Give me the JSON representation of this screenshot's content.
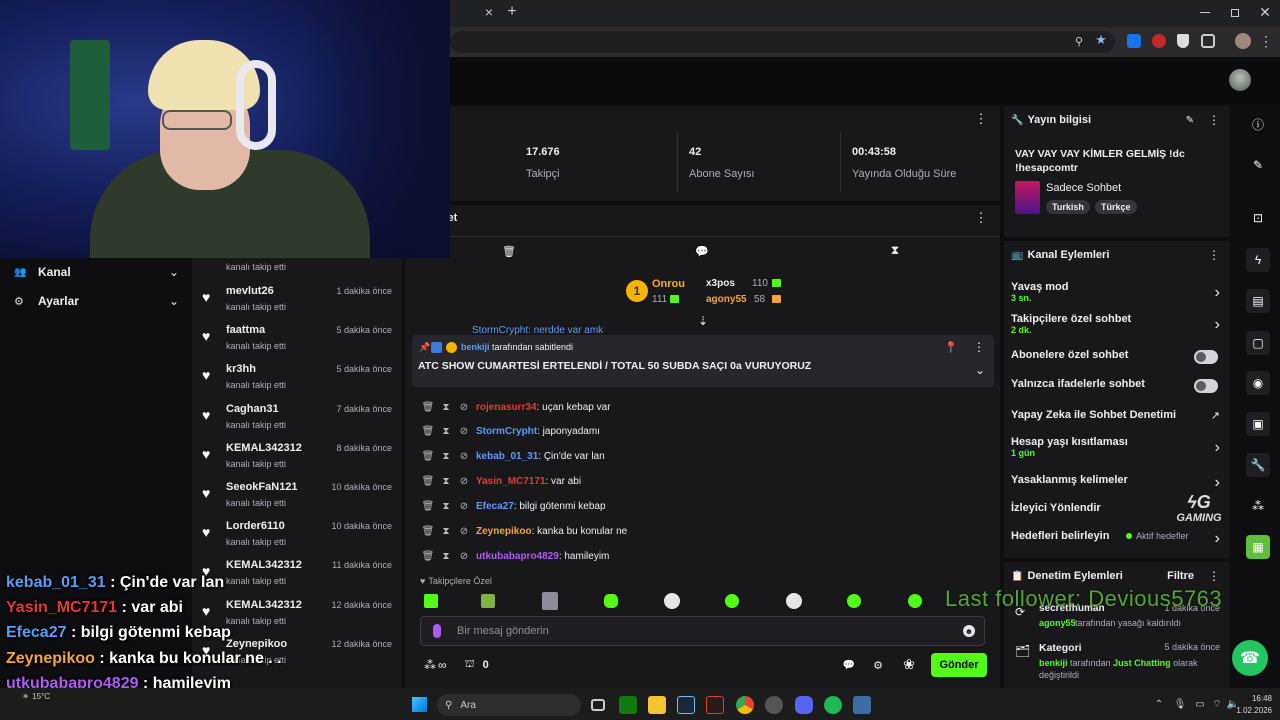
{
  "browser": {
    "tab_close": "×",
    "tab_new": "+",
    "window_controls": [
      "minimize-icon",
      "restore-icon",
      "close-icon"
    ]
  },
  "stats": {
    "followers_value": "17.676",
    "followers_label": "Takipçi",
    "subs_value": "42",
    "subs_label": "Abone Sayısı",
    "uptime_value": "00:43:58",
    "uptime_label": "Yayında Olduğu Süre"
  },
  "left_nav": {
    "channel": "Kanal",
    "settings": "Ayarlar"
  },
  "feed": {
    "top_sub": "kanalı takip etti",
    "items": [
      {
        "name": "mevlut26",
        "sub": "kanalı takip etti",
        "time": "1 dakika önce"
      },
      {
        "name": "faattma",
        "sub": "kanalı takip etti",
        "time": "5 dakika önce"
      },
      {
        "name": "kr3hh",
        "sub": "kanalı takip etti",
        "time": "5 dakika önce"
      },
      {
        "name": "Caghan31",
        "sub": "kanalı takip etti",
        "time": "7 dakika önce"
      },
      {
        "name": "KEMAL342312",
        "sub": "kanalı takip etti",
        "time": "8 dakika önce"
      },
      {
        "name": "SeeokFaN121",
        "sub": "kanalı takip etti",
        "time": "10 dakika önce"
      },
      {
        "name": "Lorder6110",
        "sub": "kanalı takip etti",
        "time": "10 dakika önce"
      },
      {
        "name": "KEMAL342312",
        "sub": "kanalı takip etti",
        "time": "11 dakika önce"
      },
      {
        "name": "KEMAL342312",
        "sub": "kanalı takip etti",
        "time": "12 dakika önce"
      },
      {
        "name": "Zeynepikoo",
        "sub": "kanalı takip etti",
        "time": "12 dakika önce"
      }
    ]
  },
  "chat": {
    "title": "Sohbet",
    "leaderboard": [
      {
        "rank": "1",
        "name": "Onrou",
        "value": "111"
      },
      {
        "name": "x3pos",
        "value": "110"
      },
      {
        "name": "agony55",
        "value": "58"
      }
    ],
    "partial_line": "StormCrypht: nerdde var amk",
    "pinned_by_user": "benkiji",
    "pinned_by_text": "tarafından sabitlendi",
    "pinned_message": "ATC SHOW CUMARTESİ ERTELENDİ / TOTAL 50 SUBDA SAÇI 0a VURUYORUZ",
    "messages": [
      {
        "user": "rojenasurr34",
        "color": "#e53935",
        "text": ": uçan kebap var"
      },
      {
        "user": "StormCrypht",
        "color": "#5b9cf6",
        "text": ": japonyadamı"
      },
      {
        "user": "kebab_01_31",
        "color": "#5b9cf6",
        "text": ": Çin'de var lan"
      },
      {
        "user": "Yasin_MC7171",
        "color": "#e53935",
        "text": ": var abi"
      },
      {
        "user": "Efeca27",
        "color": "#5b9cf6",
        "text": ": bilgi götenmi kebap"
      },
      {
        "user": "Zeynepikoo",
        "color": "#f4a63a",
        "text": ": kanka bu konular ne"
      },
      {
        "user": "utkubabapro4829",
        "color": "#b05cf5",
        "text": ": hamileyim"
      }
    ],
    "followers_only": "Takipçilere Özel",
    "input_placeholder": "Bir mesaj gönderin",
    "points": "0",
    "send_label": "Gönder"
  },
  "stream_info": {
    "title": "Yayın bilgisi",
    "stream_title": "VAY VAY VAY KİMLER GELMİŞ !dc !hesapcomtr",
    "category": "Sadece Sohbet",
    "tags": [
      "Turkish",
      "Türkçe"
    ]
  },
  "channel_actions": {
    "title": "Kanal Eylemleri",
    "items": [
      {
        "label": "Yavaş mod",
        "sub": "3 sn.",
        "control": "chevron"
      },
      {
        "label": "Takipçilere özel sohbet",
        "sub": "2 dk.",
        "control": "chevron"
      },
      {
        "label": "Abonelere özel sohbet",
        "sub": "",
        "control": "toggle"
      },
      {
        "label": "Yalnızca ifadelerle sohbet",
        "sub": "",
        "control": "toggle"
      },
      {
        "label": "Yapay Zeka ile Sohbet Denetimi",
        "sub": "",
        "control": "external"
      },
      {
        "label": "Hesap yaşı kısıtlaması",
        "sub": "1 gün",
        "control": "chevron"
      },
      {
        "label": "Yasaklanmış kelimeler",
        "sub": "",
        "control": "chevron"
      },
      {
        "label": "İzleyici Yönlendir",
        "sub": "",
        "control": "none"
      },
      {
        "label": "Hedefleri belirleyin",
        "sub": "",
        "control": "chevron"
      }
    ],
    "goals_status": "Aktif hedefler"
  },
  "mod_actions": {
    "title": "Denetim Eylemleri",
    "filter": "Filtre",
    "items": [
      {
        "title": "secretfhuman",
        "time": "1 dakika önce",
        "user": "agony55",
        "text": "tarafından yasağı kaldırıldı"
      },
      {
        "title": "Kategori",
        "time": "5 dakika önce",
        "user": "benkiji",
        "text_pre": "tarafından",
        "highlight": "Just Chatting",
        "text": "olarak değiştirildi"
      }
    ]
  },
  "overlay": {
    "lines": [
      {
        "user": "kebab_01_31",
        "color": "#5b9cf6",
        "text": " : Çin'de var lan"
      },
      {
        "user": "Yasin_MC7171",
        "color": "#e53935",
        "text": " : var abi"
      },
      {
        "user": "Efeca27",
        "color": "#5b9cf6",
        "text": " : bilgi götenmi kebap"
      },
      {
        "user": "Zeynepikoo",
        "color": "#f4a63a",
        "text": " : kanka bu konular ne . ."
      },
      {
        "user": "utkubabapro4829",
        "color": "#b05cf5",
        "text": " : hamileyim"
      }
    ],
    "last_follower": "Last follower: Devious5763",
    "logo_text": "GAMING"
  },
  "taskbar": {
    "search": "Ara",
    "temp": "15°C",
    "time": "16:48",
    "date": "1.02.2026"
  },
  "colors": {
    "accent": "#53fc18",
    "panel": "#18181b",
    "background": "#0e0e10"
  }
}
